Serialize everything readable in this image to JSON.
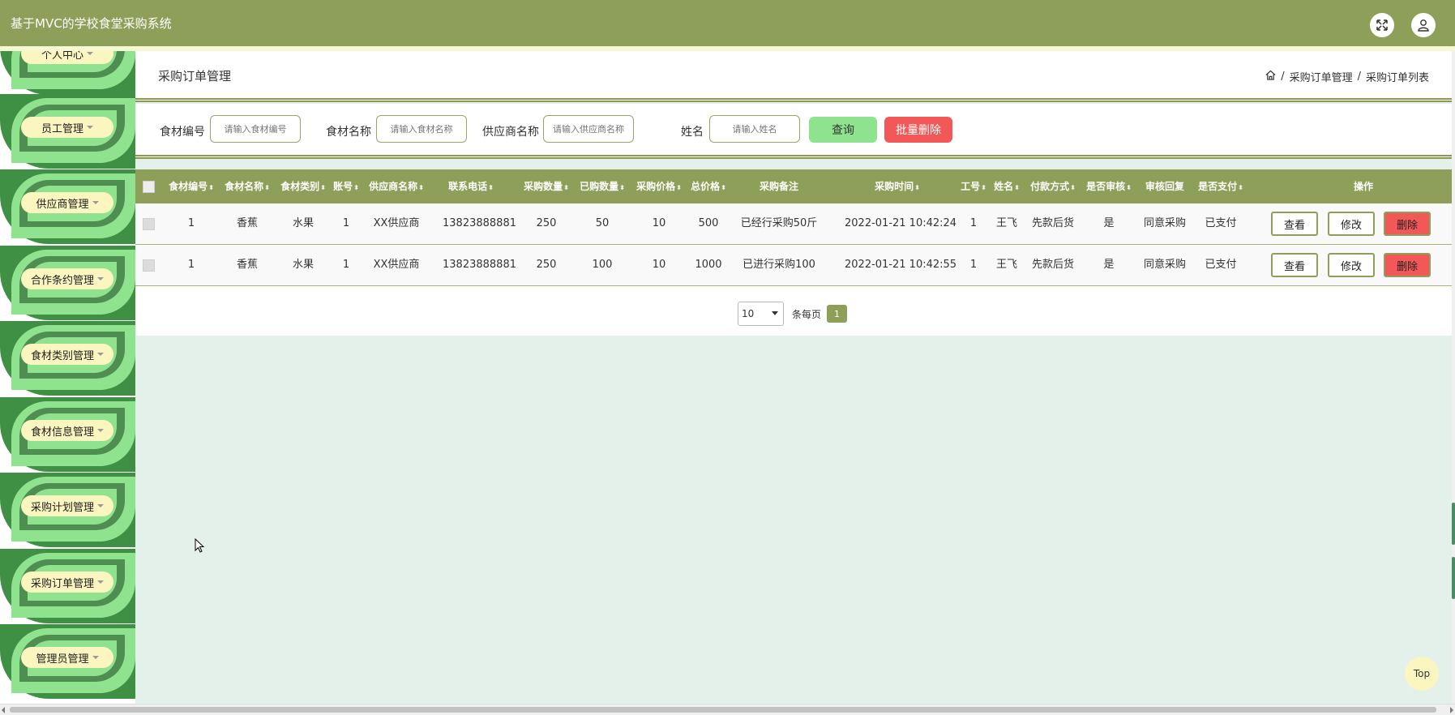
{
  "header": {
    "app_title": "基于MVC的学校食堂采购系统",
    "fullscreen_icon": "fullscreen-icon",
    "user_icon": "user-icon"
  },
  "sidebar": {
    "items": [
      {
        "label": "个人中心"
      },
      {
        "label": "员工管理"
      },
      {
        "label": "供应商管理"
      },
      {
        "label": "合作条约管理"
      },
      {
        "label": "食材类别管理"
      },
      {
        "label": "食材信息管理"
      },
      {
        "label": "采购计划管理"
      },
      {
        "label": "采购订单管理"
      },
      {
        "label": "管理员管理"
      }
    ]
  },
  "page": {
    "title": "采购订单管理",
    "breadcrumb": [
      "采购订单管理",
      "采购订单列表"
    ],
    "separator": "/"
  },
  "search": {
    "fields": [
      {
        "label": "食材编号",
        "placeholder": "请输入食材编号"
      },
      {
        "label": "食材名称",
        "placeholder": "请输入食材名称"
      },
      {
        "label": "供应商名称",
        "placeholder": "请输入供应商名称"
      },
      {
        "label": "姓名",
        "placeholder": "请输入姓名"
      }
    ],
    "query_label": "查询",
    "batch_delete_label": "批量删除"
  },
  "table": {
    "sort_glyph": "⬍",
    "columns": [
      "食材编号",
      "食材名称",
      "食材类别",
      "账号",
      "供应商名称",
      "联系电话",
      "采购数量",
      "已购数量",
      "采购价格",
      "总价格",
      "采购备注",
      "采购时间",
      "工号",
      "姓名",
      "付款方式",
      "是否审核",
      "审核回复",
      "是否支付",
      "操作"
    ],
    "rows": [
      [
        "1",
        "香蕉",
        "水果",
        "1",
        "XX供应商",
        "13823888881",
        "250",
        "50",
        "10",
        "500",
        "已经行采购50斤",
        "2022-01-21 10:42:24",
        "1",
        "王飞",
        "先款后货",
        "是",
        "同意采购",
        "已支付"
      ],
      [
        "1",
        "香蕉",
        "水果",
        "1",
        "XX供应商",
        "13823888881",
        "250",
        "100",
        "10",
        "1000",
        "已进行采购100",
        "2022-01-21 10:42:55",
        "1",
        "王飞",
        "先款后货",
        "是",
        "同意采购",
        "已支付"
      ]
    ],
    "actions": {
      "view": "查看",
      "edit": "修改",
      "delete": "删除"
    }
  },
  "pagination": {
    "page_size": "10",
    "per_page_label": "条每页",
    "current_page": "1"
  },
  "top_button": "Top",
  "colors": {
    "header": "#8e9f59",
    "accent_green": "#8fe38f",
    "danger": "#f25858",
    "content_bg": "#e4f0ea"
  }
}
